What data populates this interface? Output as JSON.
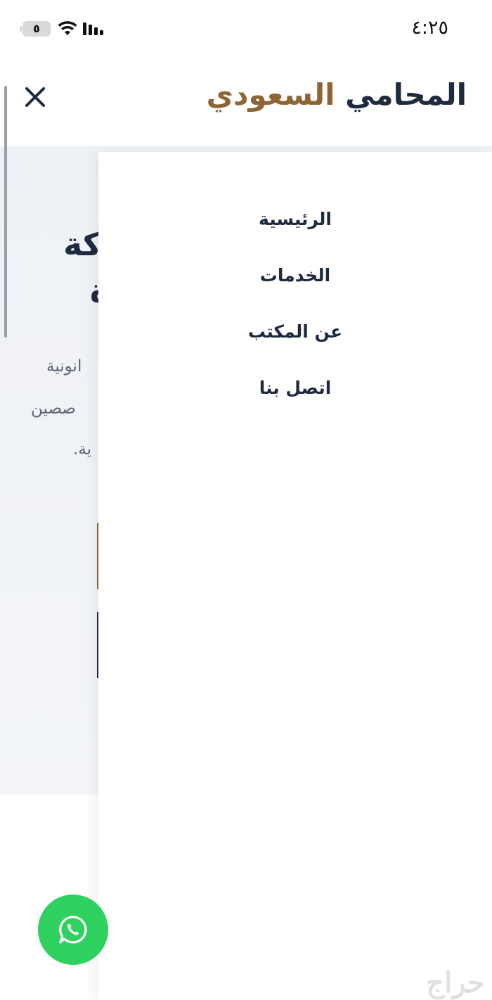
{
  "status_bar": {
    "time": "٤:٢٥",
    "battery": "٥",
    "icons": [
      "wifi-icon",
      "signal-icon",
      "battery-icon"
    ]
  },
  "header": {
    "brand_part1": "المحامي",
    "brand_part2": "السعودي",
    "close_icon": "close-icon"
  },
  "background_page": {
    "heading_line1": "كة",
    "heading_line2": "ة",
    "para_line1": "انونية",
    "para_line2": "صصين",
    "para_line3": "ية."
  },
  "menu": {
    "items": [
      {
        "label": "الرئيسية"
      },
      {
        "label": "الخدمات"
      },
      {
        "label": "عن المكتب"
      },
      {
        "label": "اتصل بنا"
      }
    ]
  },
  "whatsapp": {
    "icon": "whatsapp-icon"
  },
  "watermark": "حراج",
  "colors": {
    "navy": "#1e2a3e",
    "gold": "#8e6636",
    "whatsapp_green": "#2fd15f"
  }
}
